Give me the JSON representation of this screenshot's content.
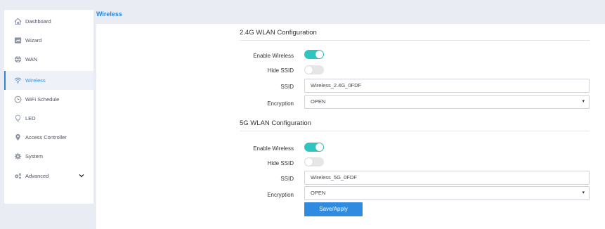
{
  "page": {
    "title": "Wireless"
  },
  "sidebar": {
    "items": [
      {
        "label": "Dashboard",
        "icon": "home-icon"
      },
      {
        "label": "Wizard",
        "icon": "wizard-icon"
      },
      {
        "label": "WAN",
        "icon": "globe-icon"
      },
      {
        "label": "Wireless",
        "icon": "wifi-icon",
        "active": true
      },
      {
        "label": "WiFi Schedule",
        "icon": "clock-icon"
      },
      {
        "label": "LED",
        "icon": "bulb-icon"
      },
      {
        "label": "Access Controller",
        "icon": "location-pin-icon"
      },
      {
        "label": "System",
        "icon": "gear-icon"
      },
      {
        "label": "Advanced",
        "icon": "gears-icon"
      }
    ]
  },
  "wlan24": {
    "title": "2.4G WLAN Configuration",
    "enable_label": "Enable Wireless",
    "enable_on": true,
    "hide_label": "Hide SSID",
    "hide_on": false,
    "ssid_label": "SSID",
    "ssid_value": "Wireless_2.4G_0FDF",
    "enc_label": "Encryption",
    "enc_value": "OPEN"
  },
  "wlan5": {
    "title": "5G WLAN Configuration",
    "enable_label": "Enable Wireless",
    "enable_on": true,
    "hide_label": "Hide SSID",
    "hide_on": false,
    "ssid_label": "SSID",
    "ssid_value": "Wireless_5G_0FDF",
    "enc_label": "Encryption",
    "enc_value": "OPEN"
  },
  "save_label": "Save/Apply",
  "colors": {
    "accent": "#2f8be0",
    "toggle_on": "#2ec4c0",
    "title": "#2b86d6"
  }
}
